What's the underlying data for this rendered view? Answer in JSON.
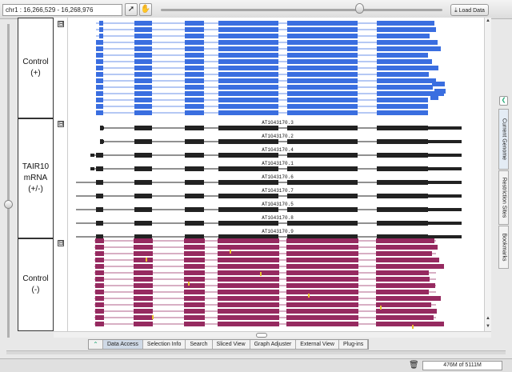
{
  "toolbar": {
    "location": "chr1 : 16,266,529 - 16,268,976",
    "pointer_icon": "arrow-pointer-icon",
    "hand_icon": "hand-pan-icon",
    "load_label": "Load Data"
  },
  "labels": {
    "control_plus_1": "Control",
    "control_plus_2": "(+)",
    "tair_1": "TAIR10",
    "tair_2": "mRNA",
    "tair_3": "(+/-)",
    "control_minus_1": "Control",
    "control_minus_2": "(-)"
  },
  "collapse_symbol": "⊟",
  "transcripts": [
    "AT1G43170.3",
    "AT1G43170.2",
    "AT1G43170.4",
    "AT1G43170.1",
    "AT1G43170.6",
    "AT1G43170.7",
    "AT1G43170.5",
    "AT1G43170.8",
    "AT1G43170.9"
  ],
  "colors": {
    "plus_reads": "#3a6ee0",
    "minus_reads": "#962a60",
    "gene_model": "#222222",
    "mismatch": "#e8c030"
  },
  "side_tabs": {
    "current": "Current Genome",
    "restriction": "Restriction Sites",
    "bookmarks": "Bookmarks"
  },
  "bottom_tabs": [
    "Data Access",
    "Selection Info",
    "Search",
    "Sliced View",
    "Graph Adjuster",
    "External View",
    "Plug-ins"
  ],
  "status": {
    "memory": "476M of 5111M"
  }
}
